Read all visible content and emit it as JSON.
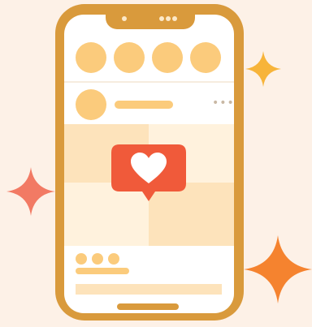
{
  "colors": {
    "background": "#fdf1e7",
    "phone_frame": "#d99a3c",
    "placeholder": "#fbcb7c",
    "placeholder_light": "#fde3bb",
    "like_badge": "#f05a3a",
    "sparkle_yellow": "#f7b43a",
    "sparkle_coral": "#f27a64",
    "sparkle_orange": "#f5832f"
  },
  "icons": {
    "like": "heart-icon",
    "sparkle": "sparkle-icon",
    "more": "more-dots-icon"
  }
}
